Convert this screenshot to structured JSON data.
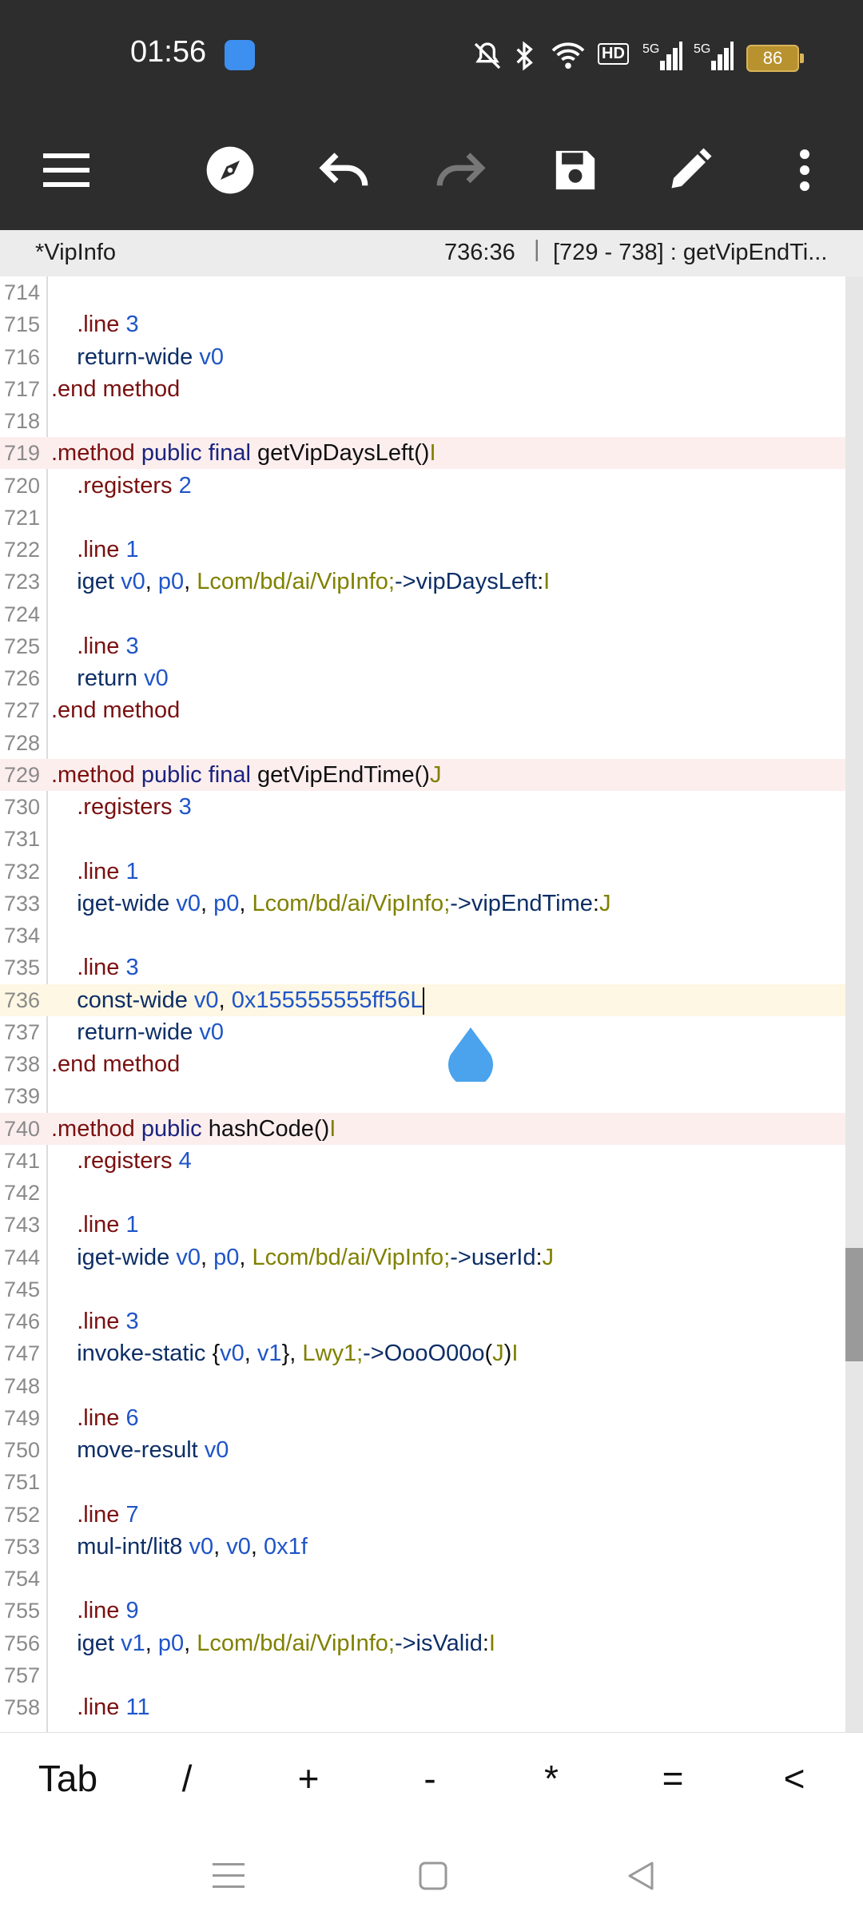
{
  "status_bar": {
    "time": "01:56",
    "battery": "86",
    "icons": [
      "app-notification-icon",
      "mute-icon",
      "bluetooth-icon",
      "wifi-icon",
      "hd-icon",
      "5g-signal-icon",
      "5g-signal-icon",
      "battery-icon"
    ]
  },
  "toolbar": {
    "buttons": [
      "menu-icon",
      "compass-icon",
      "undo-icon",
      "redo-icon",
      "save-icon",
      "edit-icon",
      "more-icon"
    ]
  },
  "title_bar": {
    "file": "*VipInfo",
    "position": "736:36",
    "separator": "|",
    "range": "[729 - 738] : getVipEndTi..."
  },
  "editor": {
    "lines": [
      {
        "n": "714",
        "t": ""
      },
      {
        "n": "715",
        "t": ".line 3"
      },
      {
        "n": "716",
        "t": "return-wide v0"
      },
      {
        "n": "717",
        "t": ".end method"
      },
      {
        "n": "718",
        "t": ""
      },
      {
        "n": "719",
        "t": ".method public final getVipDaysLeft()I"
      },
      {
        "n": "720",
        "t": ".registers 2"
      },
      {
        "n": "721",
        "t": ""
      },
      {
        "n": "722",
        "t": ".line 1"
      },
      {
        "n": "723",
        "t": "iget v0, p0, Lcom/bd/ai/VipInfo;->vipDaysLeft:I"
      },
      {
        "n": "724",
        "t": ""
      },
      {
        "n": "725",
        "t": ".line 3"
      },
      {
        "n": "726",
        "t": "return v0"
      },
      {
        "n": "727",
        "t": ".end method"
      },
      {
        "n": "728",
        "t": ""
      },
      {
        "n": "729",
        "t": ".method public final getVipEndTime()J"
      },
      {
        "n": "730",
        "t": ".registers 3"
      },
      {
        "n": "731",
        "t": ""
      },
      {
        "n": "732",
        "t": ".line 1"
      },
      {
        "n": "733",
        "t": "iget-wide v0, p0, Lcom/bd/ai/VipInfo;->vipEndTime:J"
      },
      {
        "n": "734",
        "t": ""
      },
      {
        "n": "735",
        "t": ".line 3"
      },
      {
        "n": "736",
        "t": "const-wide v0, 0x155555555ff56L"
      },
      {
        "n": "737",
        "t": "return-wide v0"
      },
      {
        "n": "738",
        "t": ".end method"
      },
      {
        "n": "739",
        "t": ""
      },
      {
        "n": "740",
        "t": ".method public hashCode()I"
      },
      {
        "n": "741",
        "t": ".registers 4"
      },
      {
        "n": "742",
        "t": ""
      },
      {
        "n": "743",
        "t": ".line 1"
      },
      {
        "n": "744",
        "t": "iget-wide v0, p0, Lcom/bd/ai/VipInfo;->userId:J"
      },
      {
        "n": "745",
        "t": ""
      },
      {
        "n": "746",
        "t": ".line 3"
      },
      {
        "n": "747",
        "t": "invoke-static {v0, v1}, Lwy1;->OooO00o(J)I"
      },
      {
        "n": "748",
        "t": ""
      },
      {
        "n": "749",
        "t": ".line 6"
      },
      {
        "n": "750",
        "t": "move-result v0"
      },
      {
        "n": "751",
        "t": ""
      },
      {
        "n": "752",
        "t": ".line 7"
      },
      {
        "n": "753",
        "t": "mul-int/lit8 v0, v0, 0x1f"
      },
      {
        "n": "754",
        "t": ""
      },
      {
        "n": "755",
        "t": ".line 9"
      },
      {
        "n": "756",
        "t": "iget v1, p0, Lcom/bd/ai/VipInfo;->isValid:I"
      },
      {
        "n": "757",
        "t": ""
      },
      {
        "n": "758",
        "t": ".line 11"
      }
    ]
  },
  "keys": [
    "Tab",
    "/",
    "+",
    "-",
    "*",
    "=",
    "<"
  ],
  "nav": [
    "recents-icon",
    "home-icon",
    "back-icon"
  ]
}
